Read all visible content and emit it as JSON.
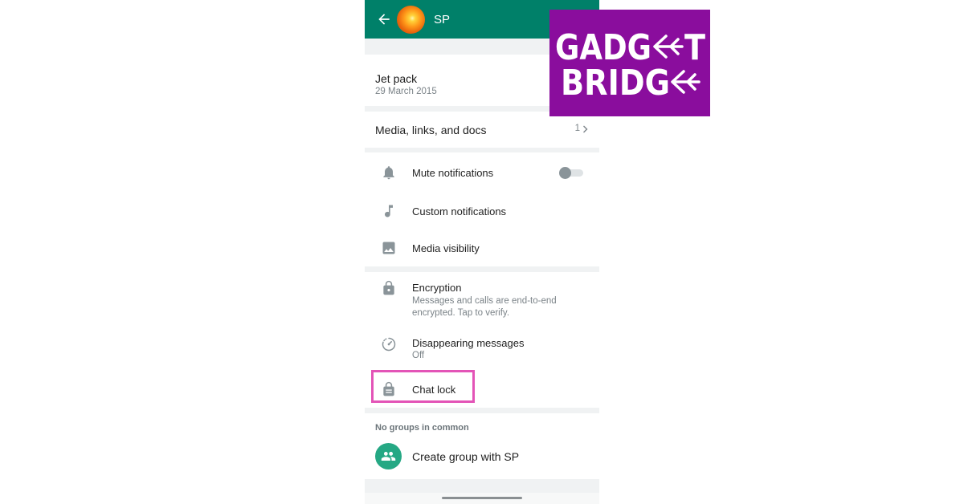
{
  "header": {
    "contact_name": "SP",
    "back_icon": "arrow-left-icon",
    "avatar_icon": "contact-avatar"
  },
  "about": {
    "title": "Jet pack",
    "date": "29 March 2015"
  },
  "media": {
    "label": "Media, links, and docs",
    "count": "1",
    "chevron_icon": "chevron-right-icon"
  },
  "notifications": {
    "mute_label": "Mute notifications",
    "mute_enabled": false,
    "custom_label": "Custom notifications",
    "visibility_label": "Media visibility"
  },
  "privacy": {
    "encryption_title": "Encryption",
    "encryption_sub_line1": "Messages and calls are end-to-end",
    "encryption_sub_line2": "encrypted. Tap to verify.",
    "disappearing_title": "Disappearing messages",
    "disappearing_value": "Off",
    "chat_lock_label": "Chat lock"
  },
  "groups": {
    "heading": "No groups in common",
    "create_label": "Create group with SP"
  },
  "logo": {
    "text_line1": "GADG",
    "text_line1_end": "T",
    "text_line2": "BRIDG"
  },
  "colors": {
    "app_bar": "#008069",
    "accent_green": "#25a884",
    "highlight_pink": "#e354b7",
    "logo_purple": "#8a0d9d"
  }
}
